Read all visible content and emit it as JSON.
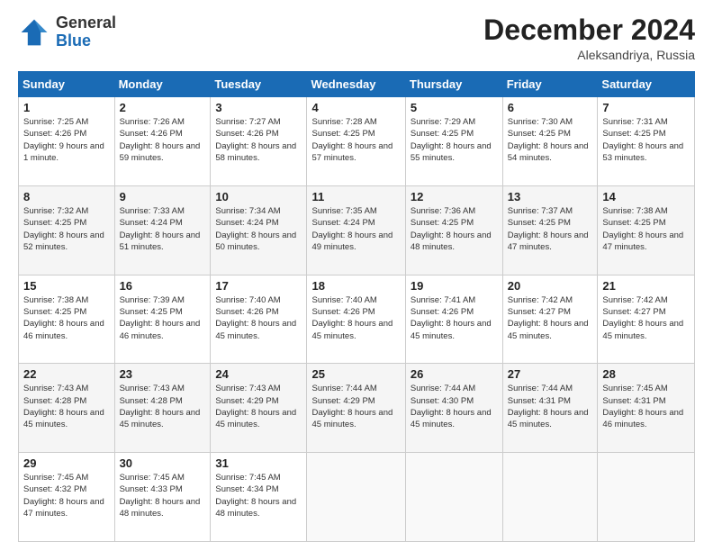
{
  "logo": {
    "general": "General",
    "blue": "Blue"
  },
  "header": {
    "month": "December 2024",
    "location": "Aleksandriya, Russia"
  },
  "weekdays": [
    "Sunday",
    "Monday",
    "Tuesday",
    "Wednesday",
    "Thursday",
    "Friday",
    "Saturday"
  ],
  "weeks": [
    [
      {
        "day": "1",
        "sunrise": "7:25 AM",
        "sunset": "4:26 PM",
        "daylight": "9 hours and 1 minute."
      },
      {
        "day": "2",
        "sunrise": "7:26 AM",
        "sunset": "4:26 PM",
        "daylight": "8 hours and 59 minutes."
      },
      {
        "day": "3",
        "sunrise": "7:27 AM",
        "sunset": "4:26 PM",
        "daylight": "8 hours and 58 minutes."
      },
      {
        "day": "4",
        "sunrise": "7:28 AM",
        "sunset": "4:25 PM",
        "daylight": "8 hours and 57 minutes."
      },
      {
        "day": "5",
        "sunrise": "7:29 AM",
        "sunset": "4:25 PM",
        "daylight": "8 hours and 55 minutes."
      },
      {
        "day": "6",
        "sunrise": "7:30 AM",
        "sunset": "4:25 PM",
        "daylight": "8 hours and 54 minutes."
      },
      {
        "day": "7",
        "sunrise": "7:31 AM",
        "sunset": "4:25 PM",
        "daylight": "8 hours and 53 minutes."
      }
    ],
    [
      {
        "day": "8",
        "sunrise": "7:32 AM",
        "sunset": "4:25 PM",
        "daylight": "8 hours and 52 minutes."
      },
      {
        "day": "9",
        "sunrise": "7:33 AM",
        "sunset": "4:24 PM",
        "daylight": "8 hours and 51 minutes."
      },
      {
        "day": "10",
        "sunrise": "7:34 AM",
        "sunset": "4:24 PM",
        "daylight": "8 hours and 50 minutes."
      },
      {
        "day": "11",
        "sunrise": "7:35 AM",
        "sunset": "4:24 PM",
        "daylight": "8 hours and 49 minutes."
      },
      {
        "day": "12",
        "sunrise": "7:36 AM",
        "sunset": "4:25 PM",
        "daylight": "8 hours and 48 minutes."
      },
      {
        "day": "13",
        "sunrise": "7:37 AM",
        "sunset": "4:25 PM",
        "daylight": "8 hours and 47 minutes."
      },
      {
        "day": "14",
        "sunrise": "7:38 AM",
        "sunset": "4:25 PM",
        "daylight": "8 hours and 47 minutes."
      }
    ],
    [
      {
        "day": "15",
        "sunrise": "7:38 AM",
        "sunset": "4:25 PM",
        "daylight": "8 hours and 46 minutes."
      },
      {
        "day": "16",
        "sunrise": "7:39 AM",
        "sunset": "4:25 PM",
        "daylight": "8 hours and 46 minutes."
      },
      {
        "day": "17",
        "sunrise": "7:40 AM",
        "sunset": "4:26 PM",
        "daylight": "8 hours and 45 minutes."
      },
      {
        "day": "18",
        "sunrise": "7:40 AM",
        "sunset": "4:26 PM",
        "daylight": "8 hours and 45 minutes."
      },
      {
        "day": "19",
        "sunrise": "7:41 AM",
        "sunset": "4:26 PM",
        "daylight": "8 hours and 45 minutes."
      },
      {
        "day": "20",
        "sunrise": "7:42 AM",
        "sunset": "4:27 PM",
        "daylight": "8 hours and 45 minutes."
      },
      {
        "day": "21",
        "sunrise": "7:42 AM",
        "sunset": "4:27 PM",
        "daylight": "8 hours and 45 minutes."
      }
    ],
    [
      {
        "day": "22",
        "sunrise": "7:43 AM",
        "sunset": "4:28 PM",
        "daylight": "8 hours and 45 minutes."
      },
      {
        "day": "23",
        "sunrise": "7:43 AM",
        "sunset": "4:28 PM",
        "daylight": "8 hours and 45 minutes."
      },
      {
        "day": "24",
        "sunrise": "7:43 AM",
        "sunset": "4:29 PM",
        "daylight": "8 hours and 45 minutes."
      },
      {
        "day": "25",
        "sunrise": "7:44 AM",
        "sunset": "4:29 PM",
        "daylight": "8 hours and 45 minutes."
      },
      {
        "day": "26",
        "sunrise": "7:44 AM",
        "sunset": "4:30 PM",
        "daylight": "8 hours and 45 minutes."
      },
      {
        "day": "27",
        "sunrise": "7:44 AM",
        "sunset": "4:31 PM",
        "daylight": "8 hours and 45 minutes."
      },
      {
        "day": "28",
        "sunrise": "7:45 AM",
        "sunset": "4:31 PM",
        "daylight": "8 hours and 46 minutes."
      }
    ],
    [
      {
        "day": "29",
        "sunrise": "7:45 AM",
        "sunset": "4:32 PM",
        "daylight": "8 hours and 47 minutes."
      },
      {
        "day": "30",
        "sunrise": "7:45 AM",
        "sunset": "4:33 PM",
        "daylight": "8 hours and 48 minutes."
      },
      {
        "day": "31",
        "sunrise": "7:45 AM",
        "sunset": "4:34 PM",
        "daylight": "8 hours and 48 minutes."
      },
      null,
      null,
      null,
      null
    ]
  ]
}
